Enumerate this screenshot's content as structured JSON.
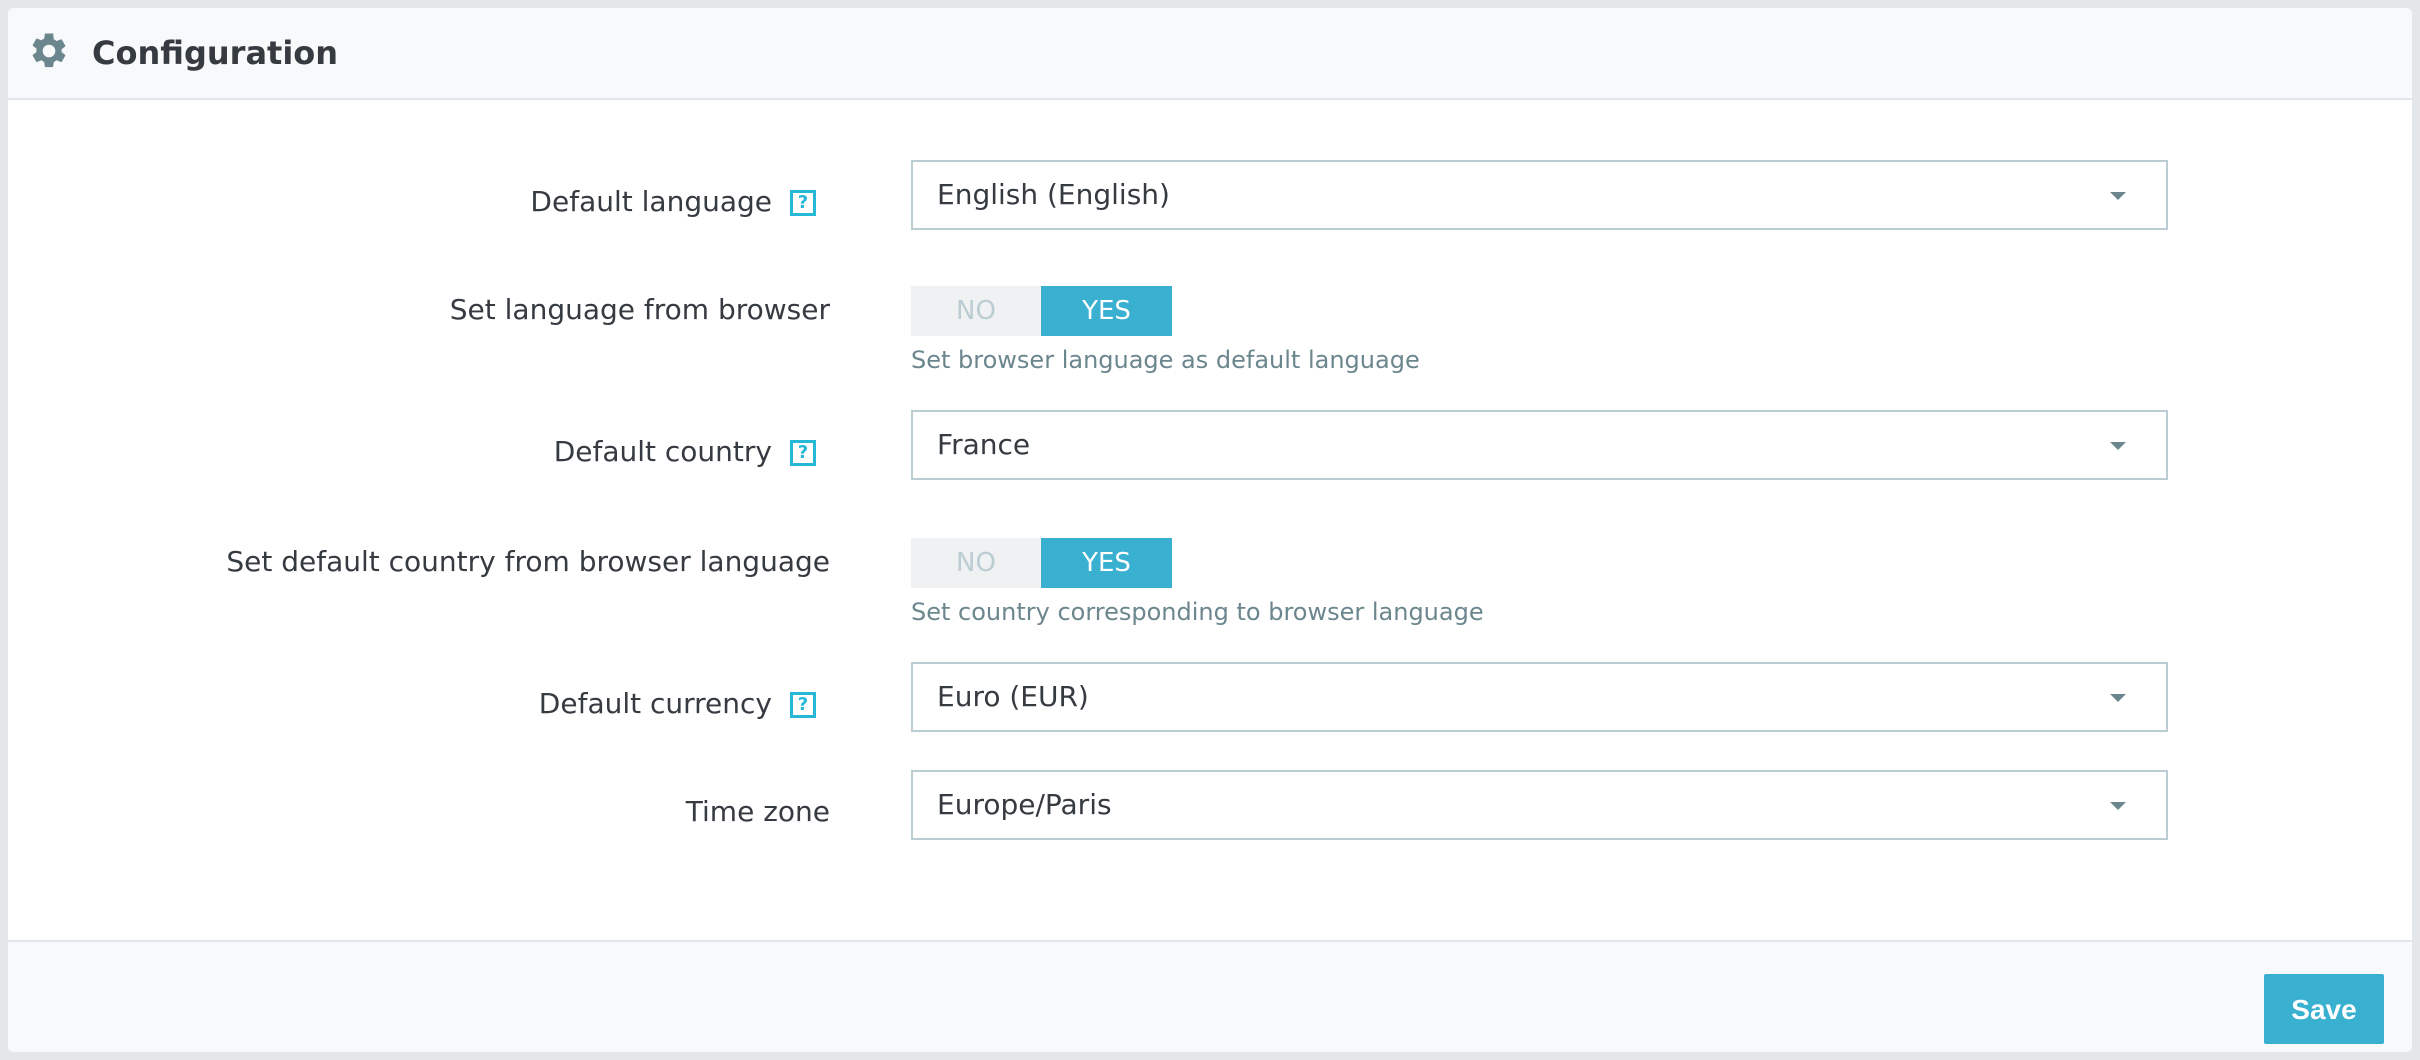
{
  "header": {
    "title": "Configuration",
    "icon": "gear-icon"
  },
  "fields": {
    "default_language": {
      "label": "Default language",
      "help": "?",
      "value": "English (English)"
    },
    "language_from_browser": {
      "label": "Set language from browser",
      "no_label": "NO",
      "yes_label": "YES",
      "selected": "YES",
      "hint": "Set browser language as default language"
    },
    "default_country": {
      "label": "Default country",
      "help": "?",
      "value": "France"
    },
    "country_from_browser": {
      "label": "Set default country from browser language",
      "no_label": "NO",
      "yes_label": "YES",
      "selected": "YES",
      "hint": "Set country corresponding to browser language"
    },
    "default_currency": {
      "label": "Default currency",
      "help": "?",
      "value": "Euro (EUR)"
    },
    "time_zone": {
      "label": "Time zone",
      "value": "Europe/Paris"
    }
  },
  "footer": {
    "save_label": "Save"
  },
  "colors": {
    "accent": "#3ab0d0",
    "help_icon": "#25b9d7",
    "border": "#bbcdd2",
    "text": "#363a41",
    "muted": "#6c868e"
  }
}
